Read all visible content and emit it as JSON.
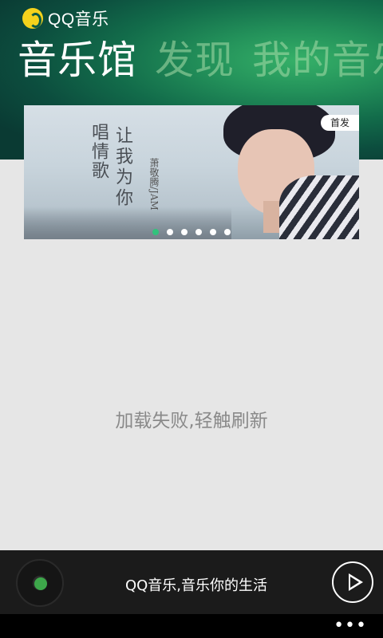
{
  "app": {
    "title": "QQ音乐"
  },
  "pivot": {
    "items": [
      "音乐馆",
      "发现",
      "我的音乐"
    ]
  },
  "banner": {
    "line1": "唱情歌",
    "line2": "让我为你",
    "artist": "萧敬腾/JAM",
    "badge": "首发",
    "dot_count": 6,
    "active_dot": 0
  },
  "status": {
    "error": "加载失败,轻触刷新"
  },
  "player": {
    "now_playing": "QQ音乐,音乐你的生活"
  },
  "appbar": {
    "more": "•••"
  }
}
